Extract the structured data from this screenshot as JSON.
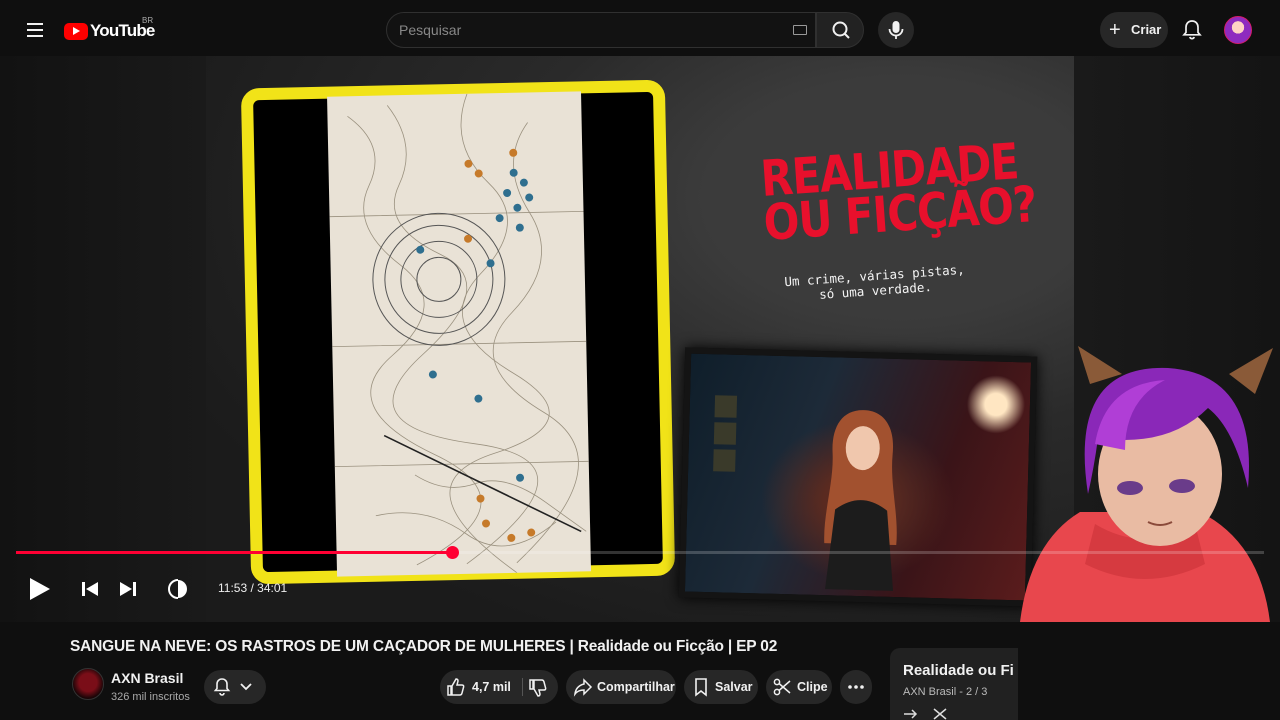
{
  "header": {
    "logo_text": "YouTube",
    "logo_region": "BR",
    "search_placeholder": "Pesquisar",
    "create_label": "Criar"
  },
  "thumbnail": {
    "title_line1": "REALIDADE",
    "title_line2": "OU FICÇÃO?",
    "subtitle_line1": "Um crime, várias pistas,",
    "subtitle_line2": "só uma verdade."
  },
  "player": {
    "time_current": "11:53",
    "time_separator": " / ",
    "time_total": "34:01",
    "progress_fraction": 0.349,
    "accent_color": "#ff0033"
  },
  "video": {
    "title": "SANGUE NA NEVE: OS RASTROS DE UM CAÇADOR DE MULHERES | Realidade ou Ficção | EP 02",
    "channel_name": "AXN Brasil",
    "channel_subscribers": "326 mil inscritos",
    "like_count": "4,7 mil",
    "share_label": "Compartilhar",
    "save_label": "Salvar",
    "clip_label": "Clipe"
  },
  "playlist": {
    "title": "Realidade ou Fi",
    "meta": "AXN Brasil - 2 / 3"
  },
  "colors": {
    "background": "#0f0f0f",
    "frame_yellow": "#f1e318",
    "title_red": "#e8102c",
    "brand_red": "#ff0000"
  }
}
